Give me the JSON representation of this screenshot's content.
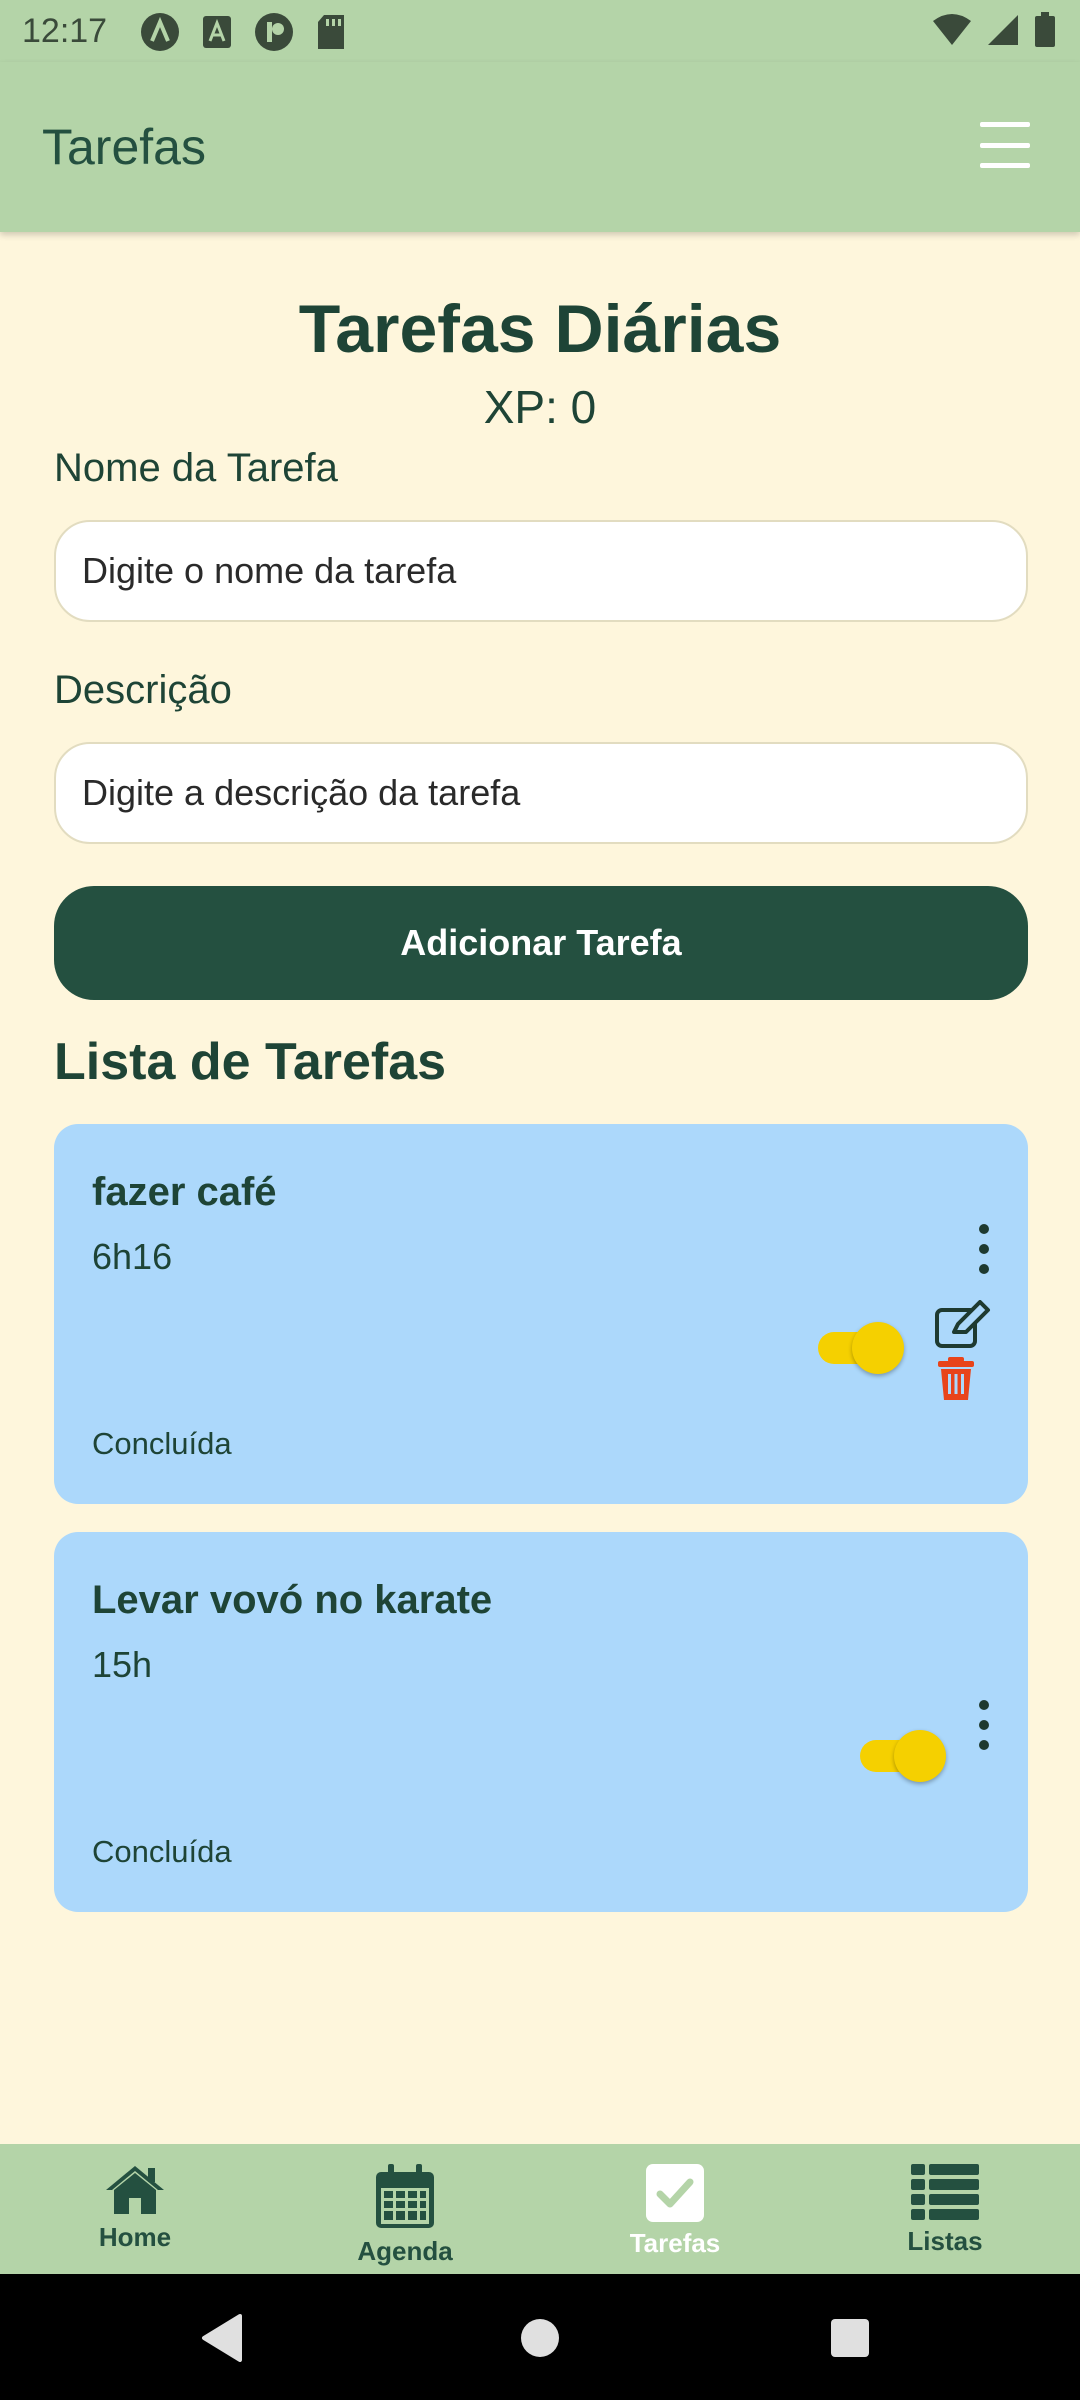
{
  "status_bar": {
    "time": "12:17"
  },
  "app_bar": {
    "title": "Tarefas",
    "menu_icon": "hamburger-menu-icon"
  },
  "header": {
    "title": "Tarefas Diárias",
    "xp": "XP: 0"
  },
  "form": {
    "name_label": "Nome da Tarefa",
    "name_placeholder": "Digite o nome da tarefa",
    "desc_label": "Descrição",
    "desc_placeholder": "Digite a descrição da tarefa",
    "add_button": "Adicionar Tarefa"
  },
  "task_list": {
    "title": "Lista de Tarefas",
    "tasks": [
      {
        "name": "fazer café",
        "time": "6h16",
        "status": "Concluída",
        "completed": true,
        "actions_expanded": true
      },
      {
        "name": "Levar vovó no karate",
        "time": "15h",
        "status": "Concluída",
        "completed": true,
        "actions_expanded": false
      }
    ]
  },
  "bottom_nav": {
    "items": [
      {
        "label": "Home",
        "icon": "home-icon"
      },
      {
        "label": "Agenda",
        "icon": "calendar-icon"
      },
      {
        "label": "Tarefas",
        "icon": "check-square-icon",
        "active": true
      },
      {
        "label": "Listas",
        "icon": "list-icon"
      }
    ]
  },
  "colors": {
    "app_bar": "#b4d4a8",
    "background": "#fef6dc",
    "primary": "#245040",
    "card": "#acd8fb",
    "toggle": "#f5d000",
    "delete": "#e8441a"
  }
}
